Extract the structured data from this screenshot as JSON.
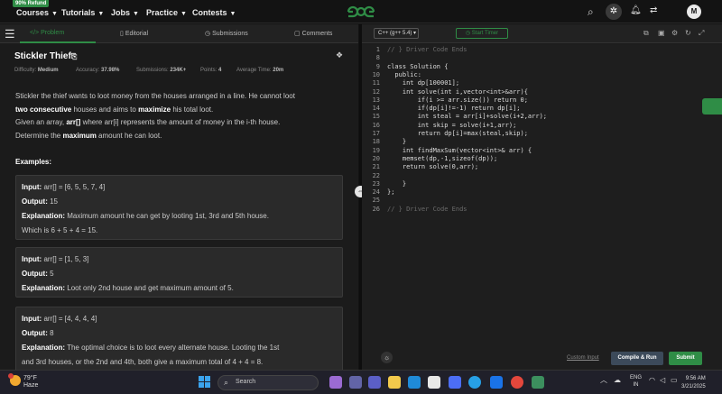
{
  "topbar": {
    "refund_badge": "90% Refund",
    "nav": [
      "Courses",
      "Tutorials",
      "Jobs",
      "Practice",
      "Contests"
    ],
    "logo_text": "GfG",
    "avatar_letter": "M"
  },
  "left": {
    "tabs": [
      "Problem",
      "Editorial",
      "Submissions",
      "Comments"
    ],
    "title": "Stickler Thief",
    "meta": {
      "difficulty_label": "Difficulty:",
      "difficulty": "Medium",
      "accuracy_label": "Accuracy:",
      "accuracy": "37.98%",
      "submissions_label": "Submissions:",
      "submissions": "234K+",
      "points_label": "Points:",
      "points": "4",
      "time_label": "Average Time:",
      "time": "20m"
    },
    "desc": {
      "l1": "Stickler the thief wants to loot money from the houses arranged in a line. He cannot loot",
      "l2a": "two consecutive",
      "l2b": " houses and aims to ",
      "l2c": "maximize",
      "l2d": " his total loot.",
      "l3a": "Given an array, ",
      "l3b": "arr[]",
      "l3c": " where arr[i] represents the amount of money in the i-th house.",
      "l4a": "Determine the ",
      "l4b": "maximum",
      "l4c": " amount he can loot."
    },
    "examples_title": "Examples:",
    "examples": [
      {
        "input_label": "Input:",
        "input": " arr[] = [6, 5, 5, 7, 4]",
        "output_label": "Output:",
        "output": " 15",
        "expl_label": "Explanation:",
        "expl1": " Maximum amount he can get by looting 1st, 3rd and 5th house.",
        "expl2": "Which is 6 + 5 + 4 = 15."
      },
      {
        "input_label": "Input:",
        "input": " arr[] = [1, 5, 3]",
        "output_label": "Output:",
        "output": " 5",
        "expl_label": "Explanation:",
        "expl1": " Loot only 2nd house and get maximum amount of 5.",
        "expl2": ""
      },
      {
        "input_label": "Input:",
        "input": " arr[] = [4, 4, 4, 4]",
        "output_label": "Output:",
        "output": " 8",
        "expl_label": "Explanation:",
        "expl1": " The optimal choice is to loot every alternate house. Looting the 1st",
        "expl2": "and 3rd houses, or the 2nd and 4th, both give a maximum total of 4 + 4 = 8."
      }
    ]
  },
  "right": {
    "language": "C++ (g++ 5.4)",
    "timer_label": "Start Timer",
    "lines": [
      {
        "n": "1",
        "code": "// } Driver Code Ends",
        "fold": true
      },
      {
        "n": "8",
        "code": ""
      },
      {
        "n": "9",
        "code": "class Solution {"
      },
      {
        "n": "10",
        "code": "  public:"
      },
      {
        "n": "11",
        "code": "    int dp[100001];"
      },
      {
        "n": "12",
        "code": "    int solve(int i,vector<int>&arr){"
      },
      {
        "n": "13",
        "code": "        if(i >= arr.size()) return 0;"
      },
      {
        "n": "14",
        "code": "        if(dp[i]!=-1) return dp[i];"
      },
      {
        "n": "15",
        "code": "        int steal = arr[i]+solve(i+2,arr);"
      },
      {
        "n": "16",
        "code": "        int skip = solve(i+1,arr);"
      },
      {
        "n": "17",
        "code": "        return dp[i]=max(steal,skip);"
      },
      {
        "n": "18",
        "code": "    }"
      },
      {
        "n": "19",
        "code": "    int findMaxSum(vector<int>& arr) {"
      },
      {
        "n": "20",
        "code": "    memset(dp,-1,sizeof(dp));"
      },
      {
        "n": "21",
        "code": "    return solve(0,arr);"
      },
      {
        "n": "22",
        "code": ""
      },
      {
        "n": "23",
        "code": "    }"
      },
      {
        "n": "24",
        "code": "};"
      },
      {
        "n": "25",
        "code": ""
      },
      {
        "n": "26",
        "code": "// } Driver Code Ends",
        "fold": true
      }
    ],
    "custom_input": "Custom Input",
    "compile": "Compile & Run",
    "submit": "Submit"
  },
  "taskbar": {
    "temp": "79°F",
    "weather": "Haze",
    "search": "Search",
    "lang1": "ENG",
    "lang2": "IN",
    "time": "9:56 AM",
    "date": "3/21/2025"
  }
}
